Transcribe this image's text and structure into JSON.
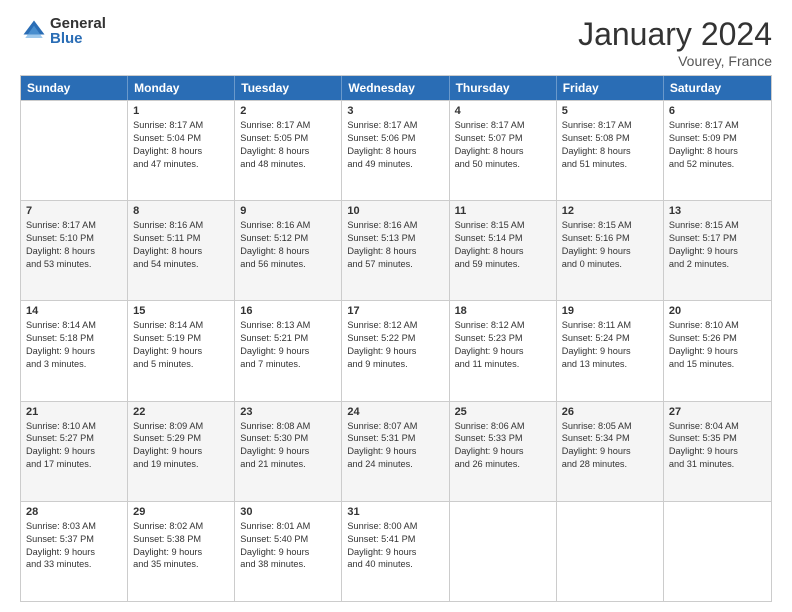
{
  "logo": {
    "general": "General",
    "blue": "Blue"
  },
  "title": "January 2024",
  "subtitle": "Vourey, France",
  "days": [
    "Sunday",
    "Monday",
    "Tuesday",
    "Wednesday",
    "Thursday",
    "Friday",
    "Saturday"
  ],
  "weeks": [
    [
      {
        "day": "",
        "lines": []
      },
      {
        "day": "1",
        "lines": [
          "Sunrise: 8:17 AM",
          "Sunset: 5:04 PM",
          "Daylight: 8 hours",
          "and 47 minutes."
        ]
      },
      {
        "day": "2",
        "lines": [
          "Sunrise: 8:17 AM",
          "Sunset: 5:05 PM",
          "Daylight: 8 hours",
          "and 48 minutes."
        ]
      },
      {
        "day": "3",
        "lines": [
          "Sunrise: 8:17 AM",
          "Sunset: 5:06 PM",
          "Daylight: 8 hours",
          "and 49 minutes."
        ]
      },
      {
        "day": "4",
        "lines": [
          "Sunrise: 8:17 AM",
          "Sunset: 5:07 PM",
          "Daylight: 8 hours",
          "and 50 minutes."
        ]
      },
      {
        "day": "5",
        "lines": [
          "Sunrise: 8:17 AM",
          "Sunset: 5:08 PM",
          "Daylight: 8 hours",
          "and 51 minutes."
        ]
      },
      {
        "day": "6",
        "lines": [
          "Sunrise: 8:17 AM",
          "Sunset: 5:09 PM",
          "Daylight: 8 hours",
          "and 52 minutes."
        ]
      }
    ],
    [
      {
        "day": "7",
        "lines": [
          "Sunrise: 8:17 AM",
          "Sunset: 5:10 PM",
          "Daylight: 8 hours",
          "and 53 minutes."
        ]
      },
      {
        "day": "8",
        "lines": [
          "Sunrise: 8:16 AM",
          "Sunset: 5:11 PM",
          "Daylight: 8 hours",
          "and 54 minutes."
        ]
      },
      {
        "day": "9",
        "lines": [
          "Sunrise: 8:16 AM",
          "Sunset: 5:12 PM",
          "Daylight: 8 hours",
          "and 56 minutes."
        ]
      },
      {
        "day": "10",
        "lines": [
          "Sunrise: 8:16 AM",
          "Sunset: 5:13 PM",
          "Daylight: 8 hours",
          "and 57 minutes."
        ]
      },
      {
        "day": "11",
        "lines": [
          "Sunrise: 8:15 AM",
          "Sunset: 5:14 PM",
          "Daylight: 8 hours",
          "and 59 minutes."
        ]
      },
      {
        "day": "12",
        "lines": [
          "Sunrise: 8:15 AM",
          "Sunset: 5:16 PM",
          "Daylight: 9 hours",
          "and 0 minutes."
        ]
      },
      {
        "day": "13",
        "lines": [
          "Sunrise: 8:15 AM",
          "Sunset: 5:17 PM",
          "Daylight: 9 hours",
          "and 2 minutes."
        ]
      }
    ],
    [
      {
        "day": "14",
        "lines": [
          "Sunrise: 8:14 AM",
          "Sunset: 5:18 PM",
          "Daylight: 9 hours",
          "and 3 minutes."
        ]
      },
      {
        "day": "15",
        "lines": [
          "Sunrise: 8:14 AM",
          "Sunset: 5:19 PM",
          "Daylight: 9 hours",
          "and 5 minutes."
        ]
      },
      {
        "day": "16",
        "lines": [
          "Sunrise: 8:13 AM",
          "Sunset: 5:21 PM",
          "Daylight: 9 hours",
          "and 7 minutes."
        ]
      },
      {
        "day": "17",
        "lines": [
          "Sunrise: 8:12 AM",
          "Sunset: 5:22 PM",
          "Daylight: 9 hours",
          "and 9 minutes."
        ]
      },
      {
        "day": "18",
        "lines": [
          "Sunrise: 8:12 AM",
          "Sunset: 5:23 PM",
          "Daylight: 9 hours",
          "and 11 minutes."
        ]
      },
      {
        "day": "19",
        "lines": [
          "Sunrise: 8:11 AM",
          "Sunset: 5:24 PM",
          "Daylight: 9 hours",
          "and 13 minutes."
        ]
      },
      {
        "day": "20",
        "lines": [
          "Sunrise: 8:10 AM",
          "Sunset: 5:26 PM",
          "Daylight: 9 hours",
          "and 15 minutes."
        ]
      }
    ],
    [
      {
        "day": "21",
        "lines": [
          "Sunrise: 8:10 AM",
          "Sunset: 5:27 PM",
          "Daylight: 9 hours",
          "and 17 minutes."
        ]
      },
      {
        "day": "22",
        "lines": [
          "Sunrise: 8:09 AM",
          "Sunset: 5:29 PM",
          "Daylight: 9 hours",
          "and 19 minutes."
        ]
      },
      {
        "day": "23",
        "lines": [
          "Sunrise: 8:08 AM",
          "Sunset: 5:30 PM",
          "Daylight: 9 hours",
          "and 21 minutes."
        ]
      },
      {
        "day": "24",
        "lines": [
          "Sunrise: 8:07 AM",
          "Sunset: 5:31 PM",
          "Daylight: 9 hours",
          "and 24 minutes."
        ]
      },
      {
        "day": "25",
        "lines": [
          "Sunrise: 8:06 AM",
          "Sunset: 5:33 PM",
          "Daylight: 9 hours",
          "and 26 minutes."
        ]
      },
      {
        "day": "26",
        "lines": [
          "Sunrise: 8:05 AM",
          "Sunset: 5:34 PM",
          "Daylight: 9 hours",
          "and 28 minutes."
        ]
      },
      {
        "day": "27",
        "lines": [
          "Sunrise: 8:04 AM",
          "Sunset: 5:35 PM",
          "Daylight: 9 hours",
          "and 31 minutes."
        ]
      }
    ],
    [
      {
        "day": "28",
        "lines": [
          "Sunrise: 8:03 AM",
          "Sunset: 5:37 PM",
          "Daylight: 9 hours",
          "and 33 minutes."
        ]
      },
      {
        "day": "29",
        "lines": [
          "Sunrise: 8:02 AM",
          "Sunset: 5:38 PM",
          "Daylight: 9 hours",
          "and 35 minutes."
        ]
      },
      {
        "day": "30",
        "lines": [
          "Sunrise: 8:01 AM",
          "Sunset: 5:40 PM",
          "Daylight: 9 hours",
          "and 38 minutes."
        ]
      },
      {
        "day": "31",
        "lines": [
          "Sunrise: 8:00 AM",
          "Sunset: 5:41 PM",
          "Daylight: 9 hours",
          "and 40 minutes."
        ]
      },
      {
        "day": "",
        "lines": []
      },
      {
        "day": "",
        "lines": []
      },
      {
        "day": "",
        "lines": []
      }
    ]
  ]
}
